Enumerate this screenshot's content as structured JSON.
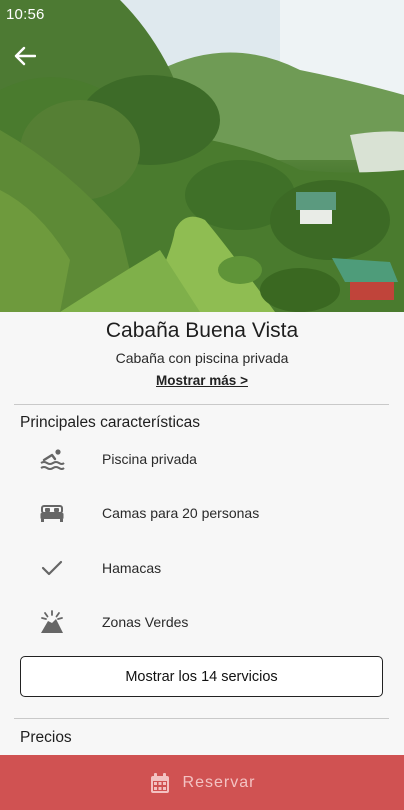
{
  "status_bar": {
    "time": "10:56"
  },
  "header": {
    "back_icon": "arrow-left-icon"
  },
  "listing": {
    "title": "Cabaña Buena Vista",
    "subtitle": "Cabaña con piscina privada",
    "more_link": "Mostrar más >"
  },
  "features_section": {
    "title": "Principales características",
    "items": [
      {
        "icon": "pool-icon",
        "label": "Piscina privada"
      },
      {
        "icon": "bed-icon",
        "label": "Camas para 20 personas"
      },
      {
        "icon": "check-icon",
        "label": "Hamacas"
      },
      {
        "icon": "mountain-icon",
        "label": "Zonas Verdes"
      }
    ],
    "services_button": "Mostrar los 14 servicios"
  },
  "prices_section": {
    "title": "Precios"
  },
  "footer": {
    "reserve_label": "Reservar",
    "reserve_icon": "calendar-icon"
  },
  "colors": {
    "accent": "#d05252",
    "accent_text": "#f3c2c2",
    "icon_gray": "#666666"
  }
}
